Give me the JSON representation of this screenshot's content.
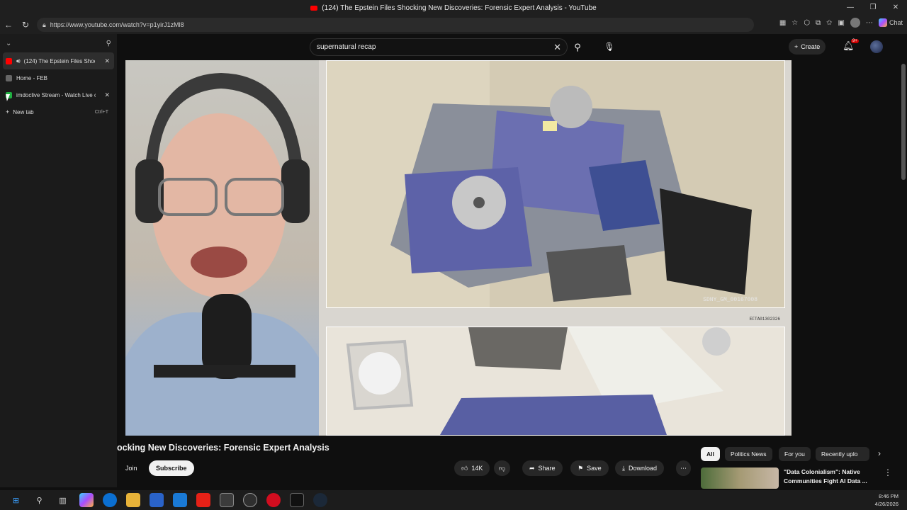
{
  "window": {
    "title": "(124) The Epstein Files Shocking New Discoveries: Forensic Expert Analysis - YouTube",
    "controls": [
      "—",
      "❐",
      "✕"
    ]
  },
  "browser": {
    "url": "https://www.youtube.com/watch?v=p1yirJ1zMl8",
    "chat_label": "Chat"
  },
  "sidebar": {
    "tabs": [
      {
        "label": "(124) The Epstein Files Shocki",
        "favicon_color": "#ff0000",
        "active": true,
        "audio": true
      },
      {
        "label": "Home - FEB",
        "favicon_color": "#666666",
        "active": false,
        "audio": false
      },
      {
        "label": "imdoclive Stream - Watch Live on",
        "favicon_color": "#1fb141",
        "active": false,
        "audio": false
      }
    ],
    "new_tab_label": "New tab",
    "new_tab_shortcut": "Ctrl+T"
  },
  "youtube": {
    "search_value": "supernatural recap",
    "create_label": "Create",
    "notification_badge": "9+",
    "video_title": "ocking New Discoveries: Forensic Expert Analysis",
    "join_label": "Join",
    "subscribe_label": "Subscribe",
    "likes": "14K",
    "share_label": "Share",
    "save_label": "Save",
    "download_label": "Download",
    "chips": [
      "All",
      "Politics News",
      "For you",
      "Recently uplo"
    ],
    "rec_title": "\"Data Colonialism\": Native Communities Fight AI Data ..."
  },
  "video": {
    "stamp_main": "SDNY_GM_00167008",
    "stamp_secondary": "EFTA01302326"
  },
  "taskbar": {
    "time": "8:46 PM",
    "date": "4/26/2026"
  },
  "colors": {
    "youtube_red": "#ff0000",
    "background": "#0f0f0f",
    "chip_selected": "#f1f1f1"
  }
}
